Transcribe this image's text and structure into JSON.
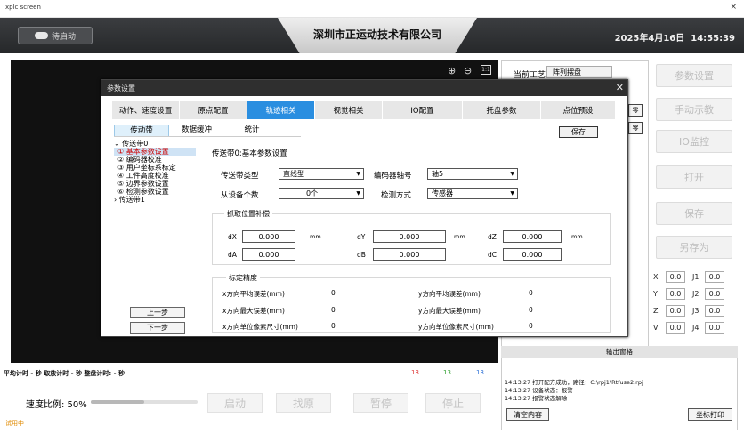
{
  "window": {
    "title": "xplc screen",
    "close": "×"
  },
  "header": {
    "start_button": "待启动",
    "company": "深圳市正运动技术有限公司",
    "date": "2025年4月16日",
    "time": "14:55:39"
  },
  "viewport": {
    "zoom_in": "⊕",
    "zoom_out": "⊖",
    "fit": "1:1"
  },
  "craft": {
    "label": "当前工艺",
    "value": "阵列摆盘"
  },
  "right_buttons": [
    "参数设置",
    "手动示教",
    "IO监控",
    "打开",
    "保存",
    "另存为"
  ],
  "partial_buttons": [
    "零",
    "零"
  ],
  "coords": {
    "rows": [
      [
        {
          "axis": "X",
          "value": "0.0"
        },
        {
          "axis": "J1",
          "value": "0.0"
        }
      ],
      [
        {
          "axis": "Y",
          "value": "0.0"
        },
        {
          "axis": "J2",
          "value": "0.0"
        }
      ],
      [
        {
          "axis": "Z",
          "value": "0.0"
        },
        {
          "axis": "J3",
          "value": "0.0"
        }
      ],
      [
        {
          "axis": "V",
          "value": "0.0"
        },
        {
          "axis": "J4",
          "value": "0.0"
        }
      ]
    ]
  },
  "dialog": {
    "title": "参数设置",
    "close": "✕",
    "tabs": [
      "动作、速度设置",
      "原点配置",
      "轨迹相关",
      "视觉相关",
      "IO配置",
      "托盘参数",
      "点位预设"
    ],
    "active_tab": 2,
    "subtabs": [
      "传动带",
      "数据缓冲",
      "统计"
    ],
    "save": "保存",
    "tree": {
      "root": "传送带0",
      "items": [
        "①  基本参数设置",
        "②  编码器校准",
        "③  用户坐标系标定",
        "④  工件高度校准",
        "⑤  边界参数设置",
        "⑥  检测参数设置"
      ],
      "other": "传送带1"
    },
    "prev": "上一步",
    "next": "下一步",
    "section_title": "传送带0:基本参数设置",
    "belt_type_label": "传送带类型",
    "belt_type_value": "直线型",
    "encoder_axis_label": "编码器轴号",
    "encoder_axis_value": "轴5",
    "slave_count_label": "从设备个数",
    "slave_count_value": "0个",
    "detect_label": "检测方式",
    "detect_value": "传感器",
    "comp_title": "抓取位置补偿",
    "comp": [
      {
        "label": "dX",
        "value": "0.000",
        "unit": "mm"
      },
      {
        "label": "dY",
        "value": "0.000",
        "unit": "mm"
      },
      {
        "label": "dZ",
        "value": "0.000",
        "unit": "mm"
      },
      {
        "label": "dA",
        "value": "0.000",
        "unit": ""
      },
      {
        "label": "dB",
        "value": "0.000",
        "unit": ""
      },
      {
        "label": "dC",
        "value": "0.000",
        "unit": ""
      }
    ],
    "precision_title": "标定精度",
    "precision": [
      {
        "label": "x方向平均误差(mm)",
        "value": "0"
      },
      {
        "label": "y方向平均误差(mm)",
        "value": "0"
      },
      {
        "label": "x方向最大误差(mm)",
        "value": "0"
      },
      {
        "label": "y方向最大误差(mm)",
        "value": "0"
      },
      {
        "label": "x方向单位像素尺寸(mm)",
        "value": "0"
      },
      {
        "label": "y方向单位像素尺寸(mm)",
        "value": "0"
      }
    ]
  },
  "bottom": {
    "timing": "平均计时   -   秒   取放计时   -   秒   整盘计时:   -   秒",
    "counts": [
      "13",
      "13",
      "13"
    ],
    "speed_label": "速度比例: 50%",
    "speed_value": 50,
    "buttons": [
      "启动",
      "找原",
      "暂停",
      "停止"
    ],
    "trial": "试用中"
  },
  "output": {
    "title": "输出窗格",
    "lines": [
      "14:13:27 打开配方成功，路径：C:\\rpj1\\Rtfuse2.rpj",
      "14:13:27 设备状态：报警",
      "14:13:27 报警状态解除"
    ],
    "clear": "清空内容",
    "print": "坐标打印"
  }
}
